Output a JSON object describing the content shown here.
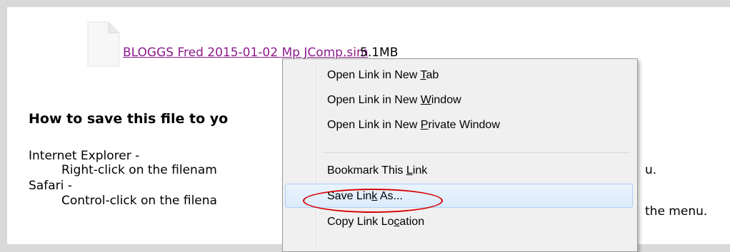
{
  "file": {
    "link_text": "BLOGGS Fred 2015-01-02 Mp JComp.sim",
    "size": "5.1MB",
    "icon": "document-icon"
  },
  "instructions": {
    "heading": "How to save this file to yo",
    "ie_label": "Internet Explorer -",
    "ie_text_left": "Right-click on the filenam",
    "ie_text_right": "u.",
    "safari_label": "Safari -",
    "safari_text_left": "Control-click on the filena",
    "safari_text_right": "the menu."
  },
  "context_menu": {
    "items": [
      {
        "pre": "Open Link in New ",
        "acc": "T",
        "post": "ab"
      },
      {
        "pre": "Open Link in New ",
        "acc": "W",
        "post": "indow"
      },
      {
        "pre": "Open Link in New ",
        "acc": "P",
        "post": "rivate Window"
      },
      {
        "pre": "Bookmark This ",
        "acc": "L",
        "post": "ink"
      },
      {
        "pre": "Save Lin",
        "acc": "k",
        "post": " As..."
      },
      {
        "pre": "Copy Link Lo",
        "acc": "c",
        "post": "ation"
      }
    ],
    "highlighted_item": "Save Link As...",
    "highlight_color": "#d40000"
  }
}
